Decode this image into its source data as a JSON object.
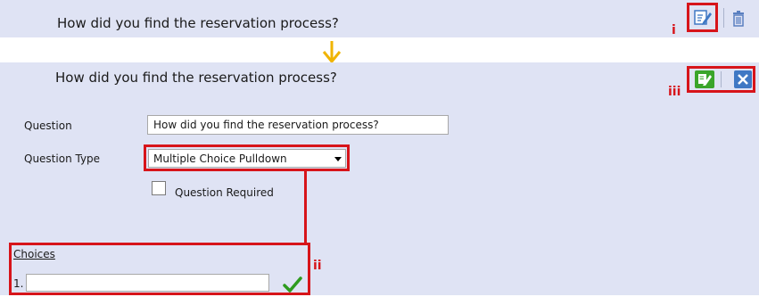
{
  "collapsed_row": {
    "question_text": "How did you find the reservation process?"
  },
  "expanded_row": {
    "question_text": "How did you find the reservation process?"
  },
  "form": {
    "question_label": "Question",
    "question_value": "How did you find the reservation process?",
    "question_type_label": "Question Type",
    "question_type_value": "Multiple Choice Pulldown",
    "required_label": "Question Required",
    "choices_label": "Choices",
    "choice_1_number": "1."
  },
  "annotations": {
    "i": "i",
    "ii": "ii",
    "iii": "iii"
  },
  "icons": [
    "edit-icon",
    "trash-icon",
    "save-icon",
    "close-icon",
    "arrow-down-icon",
    "checkmark-icon",
    "dropdown-arrow-icon"
  ],
  "colors": {
    "row_bg": "#dfe3f4",
    "annotation_red": "#d7141a",
    "arrow_yellow": "#f0b400",
    "check_green": "#2e9b1e"
  }
}
